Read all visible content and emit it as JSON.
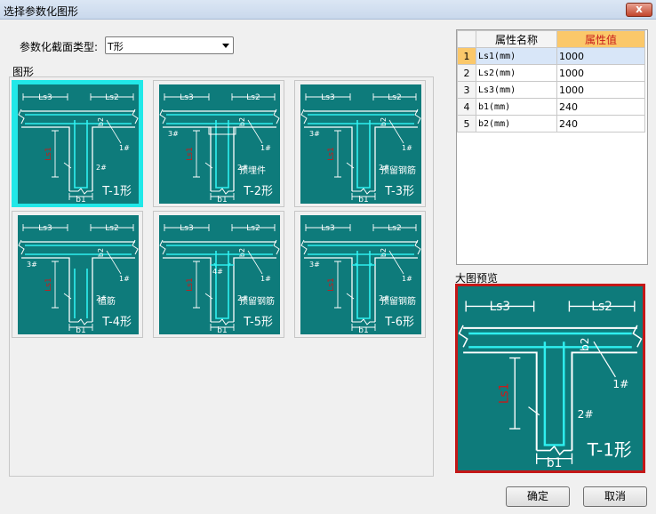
{
  "window": {
    "title": "选择参数化图形",
    "close_label": "x"
  },
  "section_type": {
    "label": "参数化截面类型:",
    "selected": "T形"
  },
  "shapes_group": {
    "label": "图形"
  },
  "tiles": [
    {
      "id": "T-1",
      "caption": "T-1形",
      "extra": "",
      "selected": true
    },
    {
      "id": "T-2",
      "caption": "T-2形",
      "extra": "预埋件",
      "selected": false
    },
    {
      "id": "T-3",
      "caption": "T-3形",
      "extra": "预留钢筋",
      "selected": false
    },
    {
      "id": "T-4",
      "caption": "T-4形",
      "extra": "植筋",
      "selected": false
    },
    {
      "id": "T-5",
      "caption": "T-5形",
      "extra": "预留钢筋",
      "selected": false
    },
    {
      "id": "T-6",
      "caption": "T-6形",
      "extra": "预留钢筋",
      "selected": false
    }
  ],
  "dim_labels": {
    "ls3": "Ls3",
    "ls2": "Ls2",
    "ls1": "Ls1",
    "b1": "b1",
    "b2": "b2",
    "r1": "1#",
    "r2": "2#",
    "r3": "3#",
    "r4": "4#"
  },
  "property_grid": {
    "headers": [
      "",
      "属性名称",
      "属性值"
    ],
    "rows": [
      {
        "index": "1",
        "name": "Ls1(mm)",
        "value": "1000"
      },
      {
        "index": "2",
        "name": "Ls2(mm)",
        "value": "1000"
      },
      {
        "index": "3",
        "name": "Ls3(mm)",
        "value": "1000"
      },
      {
        "index": "4",
        "name": "b1(mm)",
        "value": "240"
      },
      {
        "index": "5",
        "name": "b2(mm)",
        "value": "240"
      }
    ]
  },
  "preview": {
    "label": "大图预览",
    "caption": "T-1形"
  },
  "buttons": {
    "ok": "确定",
    "cancel": "取消"
  },
  "colors": {
    "panel": "#0e7b7b",
    "line": "#2ff0f0",
    "white": "#ffffff",
    "dim_red": "#c81b1b",
    "selected": "#21e8e8"
  }
}
